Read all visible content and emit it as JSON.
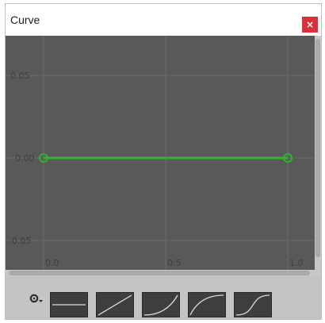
{
  "window": {
    "title": "Curve",
    "close_symbol": "×"
  },
  "curve": {
    "y_tick_labels": [
      "0.05",
      "0.00",
      "-0.05"
    ],
    "x_tick_labels": [
      "0.0",
      "0.5",
      "1.0"
    ],
    "keys": [
      {
        "time": 0.0,
        "value": 0.0
      },
      {
        "time": 1.0,
        "value": 0.0
      }
    ],
    "curve_color": "#2fb42f",
    "background_color": "#595959"
  },
  "presets": {
    "gear_icon": "gear-icon",
    "items": [
      {
        "name": "constant"
      },
      {
        "name": "linear"
      },
      {
        "name": "ease-in"
      },
      {
        "name": "ease-out"
      },
      {
        "name": "ease-in-out"
      }
    ]
  }
}
